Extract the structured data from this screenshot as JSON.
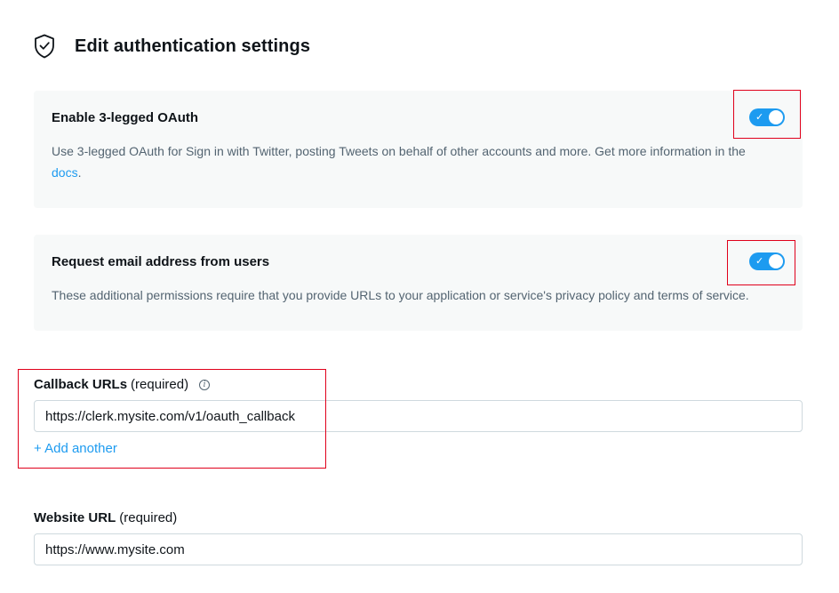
{
  "header": {
    "title": "Edit authentication settings",
    "icon": "shield-check-icon"
  },
  "oauth": {
    "title": "Enable 3-legged OAuth",
    "desc_prefix": "Use 3-legged OAuth for Sign in with Twitter, posting Tweets on behalf of other accounts and more. Get more information in the ",
    "desc_link": "docs",
    "desc_suffix": ".",
    "enabled": true,
    "check_glyph": "✓"
  },
  "email": {
    "title": "Request email address from users",
    "desc": "These additional permissions require that you provide URLs to your application or service's privacy policy and terms of service.",
    "enabled": true,
    "check_glyph": "✓"
  },
  "callback": {
    "label": "Callback URLs",
    "required": "(required)",
    "info_glyph": "i",
    "value": "https://clerk.mysite.com/v1/oauth_callback",
    "add_another": "+ Add another"
  },
  "website": {
    "label": "Website URL",
    "required": "(required)",
    "value": "https://www.mysite.com"
  },
  "colors": {
    "accent": "#1d9bf0",
    "highlight": "#e0001b",
    "card_bg": "#f7f9f9"
  }
}
